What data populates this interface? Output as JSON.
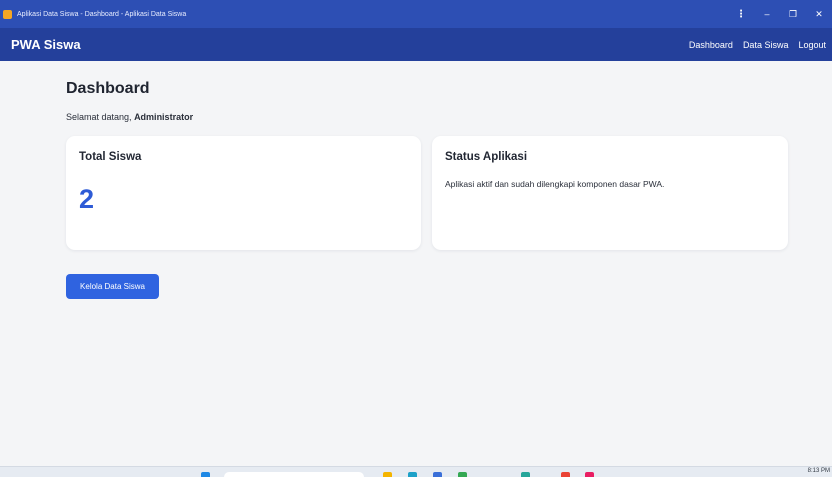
{
  "window": {
    "title": "Aplikasi Data Siswa - Dashboard - Aplikasi Data Siswa",
    "controls": {
      "menu": "⋮",
      "minimize": "–",
      "restore": "❐",
      "close": "✕"
    }
  },
  "navbar": {
    "brand": "PWA Siswa",
    "links": [
      "Dashboard",
      "Data Siswa",
      "Logout"
    ]
  },
  "main": {
    "title": "Dashboard",
    "welcome_prefix": "Selamat datang,",
    "welcome_user": "Administrator",
    "cards": {
      "total": {
        "title": "Total Siswa",
        "value": "2"
      },
      "status": {
        "title": "Status Aplikasi",
        "text": "Aplikasi aktif dan sudah dilengkapi komponen dasar PWA."
      }
    },
    "manage_button": "Kelola Data Siswa"
  },
  "taskbar": {
    "time": "8:13 PM",
    "icons": [
      {
        "name": "windows-start-icon",
        "color": "#1e88e5"
      },
      {
        "name": "file-explorer-icon",
        "color": "#f4b400"
      },
      {
        "name": "edge-icon",
        "color": "#1da1c8"
      },
      {
        "name": "store-icon",
        "color": "#3a6fd8"
      },
      {
        "name": "app-green-icon",
        "color": "#34a853"
      },
      {
        "name": "app-teal-icon",
        "color": "#26a69a"
      },
      {
        "name": "chrome-icon",
        "color": "#ea4335"
      },
      {
        "name": "app-pink-icon",
        "color": "#e91e63"
      }
    ]
  },
  "colors": {
    "titlebar": "#2d4fb4",
    "navbar": "#24409b",
    "accent": "#2f63e0",
    "stat_value": "#2e5bd6",
    "background": "#f4f5f7"
  }
}
